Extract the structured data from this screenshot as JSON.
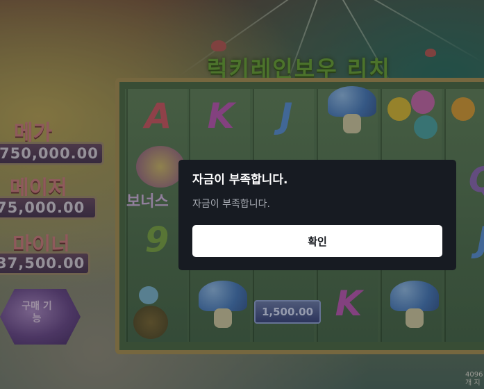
{
  "game": {
    "title": "럭키레인보우 리치",
    "jackpots": [
      {
        "label": "메가",
        "amount": "750,000.00"
      },
      {
        "label": "메이저",
        "amount": "75,000.00"
      },
      {
        "label": "마이너",
        "amount": "37,500.00"
      }
    ],
    "buy_feature_label": "구매 기능",
    "bonus_symbol_text": "보너스",
    "coin_value": "1,500.00",
    "ways_text_line1": "4096",
    "ways_text_line2": "개 지",
    "reel_symbols": [
      "A",
      "K",
      "J",
      "9",
      "K",
      "Q",
      "J"
    ]
  },
  "dialog": {
    "title": "자금이 부족합니다.",
    "message": "자금이 부족합니다.",
    "confirm_label": "확인"
  },
  "colors": {
    "dialog_bg": "#171b22",
    "confirm_bg": "#ffffff",
    "title_green": "#6aa03c",
    "jackpot_label": "#c67d80"
  }
}
